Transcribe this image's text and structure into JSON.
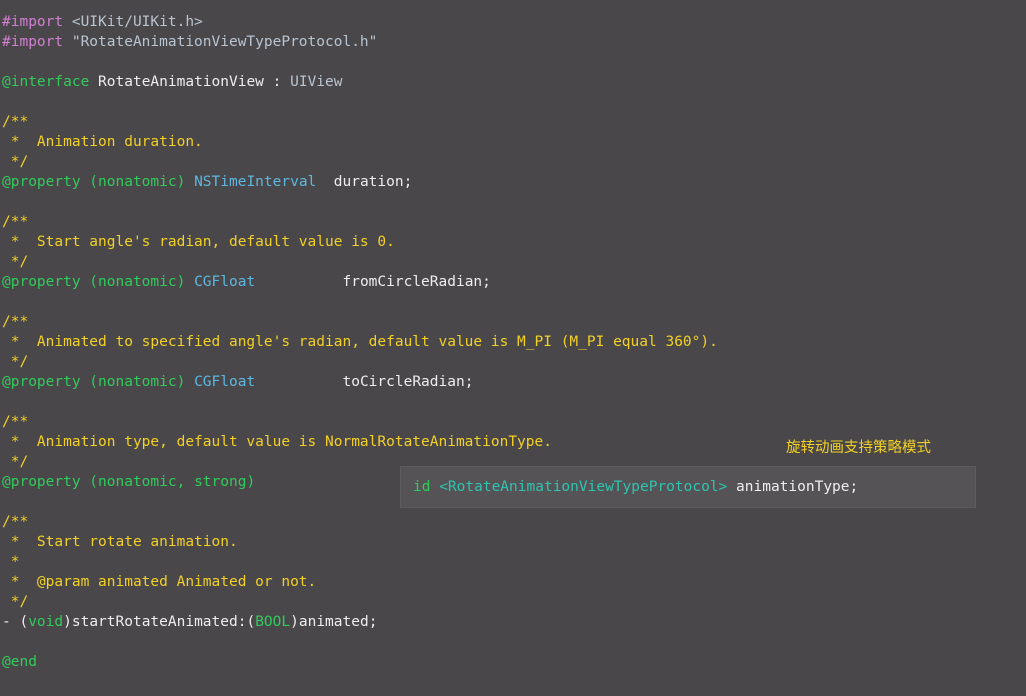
{
  "editor": {
    "background_color": "#4a474a",
    "default_text_color": "#e8e8e8",
    "language": "Objective-C",
    "colors": {
      "preprocessor": "#d17fd1",
      "include_path": "#b8c4d0",
      "keyword": "#2fcc5a",
      "type": "#5cb8e0",
      "comment": "#f2d024",
      "protocol": "#2ec4b0",
      "plain": "#ededed",
      "highlight_box_background": "#565356"
    }
  },
  "code": {
    "import1_directive": "#import",
    "import1_path": " <UIKit/UIKit.h>",
    "import2_directive": "#import",
    "import2_path": " \"RotateAnimationViewTypeProtocol.h\"",
    "interface_keyword": "@interface",
    "interface_name": " RotateAnimationView : ",
    "interface_super": "UIView",
    "doc1_open": "/**",
    "doc1_body": " *  Animation duration.",
    "doc1_close": " */",
    "prop1_keyword": "@property",
    "prop1_attrs": " (nonatomic)",
    "prop1_type": " NSTimeInterval",
    "prop1_name": "  duration;",
    "doc2_open": "/**",
    "doc2_body": " *  Start angle's radian, default value is 0.",
    "doc2_close": " */",
    "prop2_keyword": "@property",
    "prop2_attrs": " (nonatomic)",
    "prop2_type": " CGFloat",
    "prop2_name": "          fromCircleRadian;",
    "doc3_open": "/**",
    "doc3_body": " *  Animated to specified angle's radian, default value is M_PI (M_PI equal 360°).",
    "doc3_close": " */",
    "prop3_keyword": "@property",
    "prop3_attrs": " (nonatomic)",
    "prop3_type": " CGFloat",
    "prop3_name": "          toCircleRadian;",
    "doc4_open": "/**",
    "doc4_body": " *  Animation type, default value is NormalRotateAnimationType.",
    "doc4_close": " */",
    "prop4_keyword": "@property",
    "prop4_attrs": " (nonatomic, strong)",
    "highlight_id": "id ",
    "highlight_protocol": "<RotateAnimationViewTypeProtocol>",
    "highlight_name": " animationType;",
    "doc5_open": "/**",
    "doc5_body1": " *  Start rotate animation.",
    "doc5_body2": " *",
    "doc5_body3": " *  @param animated Animated or not.",
    "doc5_close": " */",
    "method_dash": "- ",
    "method_paren_open": "(",
    "method_void": "void",
    "method_paren_close": ")",
    "method_sel1": "startRotateAnimated:",
    "method_paren_open2": "(",
    "method_bool": "BOOL",
    "method_paren_close2": ")",
    "method_arg": "animated;",
    "end_keyword": "@end"
  },
  "annotation": {
    "chinese_note": "旋转动画支持策略模式",
    "color": "#f2d024"
  }
}
